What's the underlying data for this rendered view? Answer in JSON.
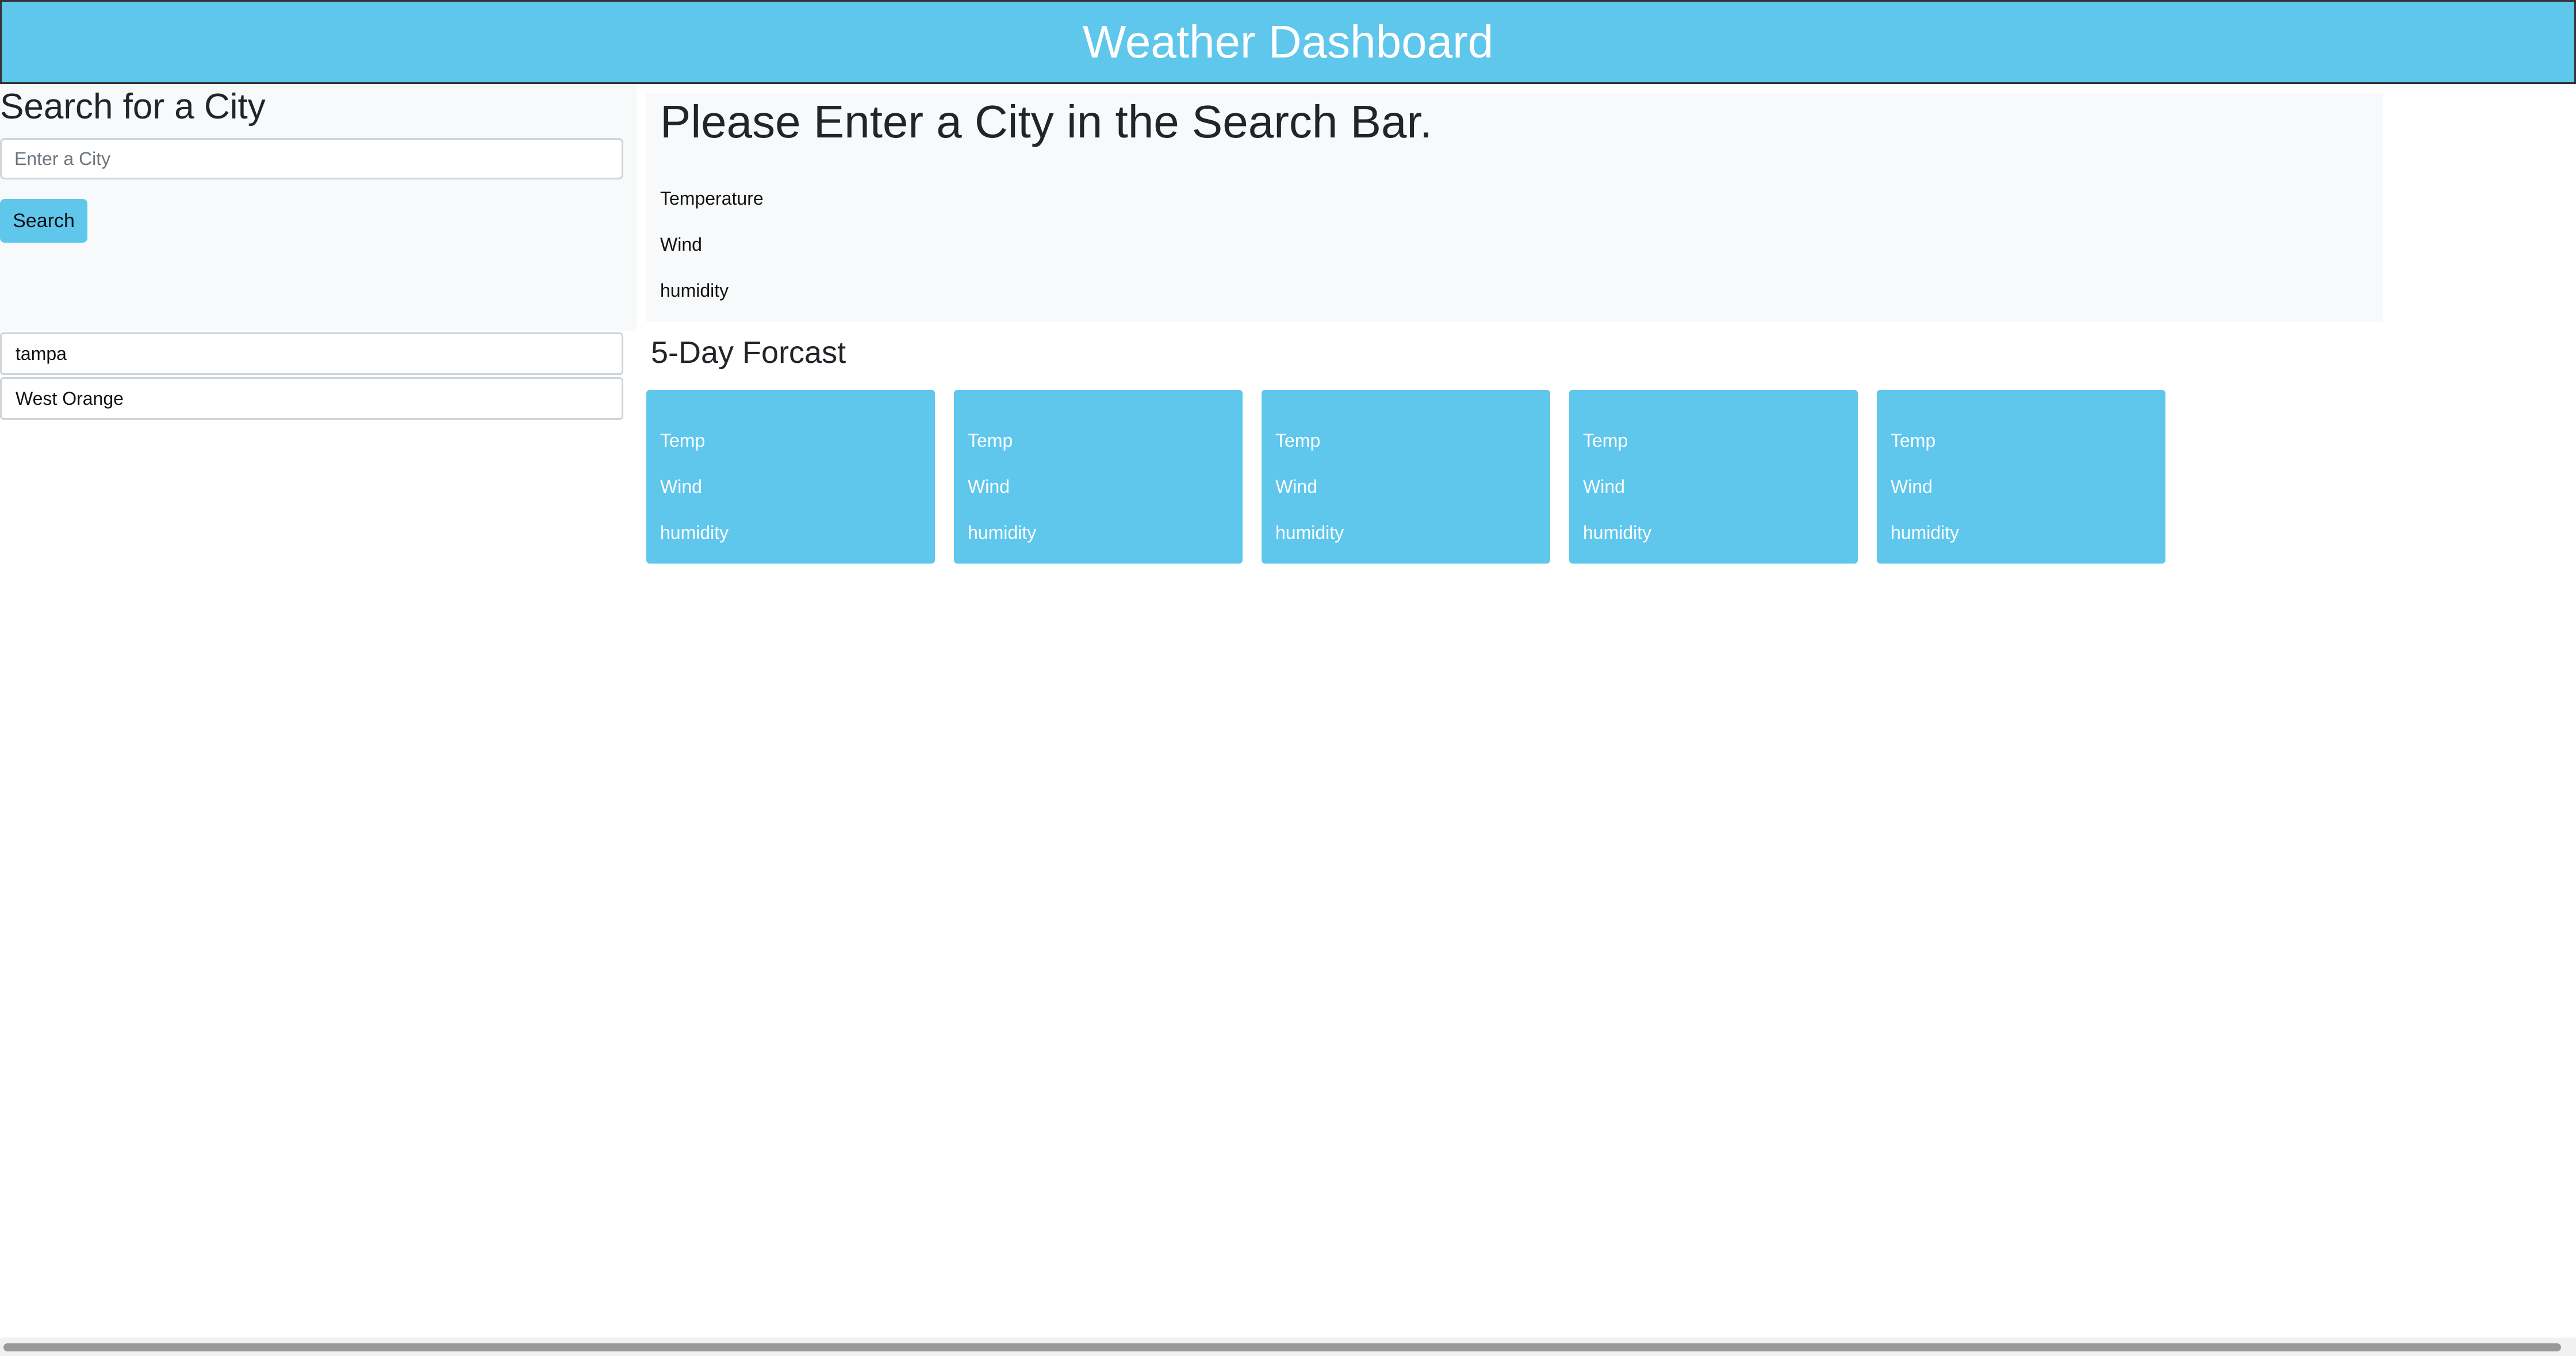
{
  "header": {
    "title": "Weather Dashboard"
  },
  "search": {
    "heading": "Search for a City",
    "placeholder": "Enter a City",
    "value": "",
    "button_label": "Search"
  },
  "history": [
    "tampa",
    "West Orange"
  ],
  "current": {
    "heading": "Please Enter a City in the Search Bar.",
    "temperature_label": "Temperature",
    "wind_label": "Wind",
    "humidity_label": "humidity"
  },
  "forecast": {
    "title": "5-Day Forcast",
    "cards": [
      {
        "temp": "Temp",
        "wind": "Wind",
        "humidity": "humidity"
      },
      {
        "temp": "Temp",
        "wind": "Wind",
        "humidity": "humidity"
      },
      {
        "temp": "Temp",
        "wind": "Wind",
        "humidity": "humidity"
      },
      {
        "temp": "Temp",
        "wind": "Wind",
        "humidity": "humidity"
      },
      {
        "temp": "Temp",
        "wind": "Wind",
        "humidity": "humidity"
      }
    ]
  },
  "colors": {
    "accent": "#5fc6ec",
    "panel_background": "#f8f9fa"
  }
}
